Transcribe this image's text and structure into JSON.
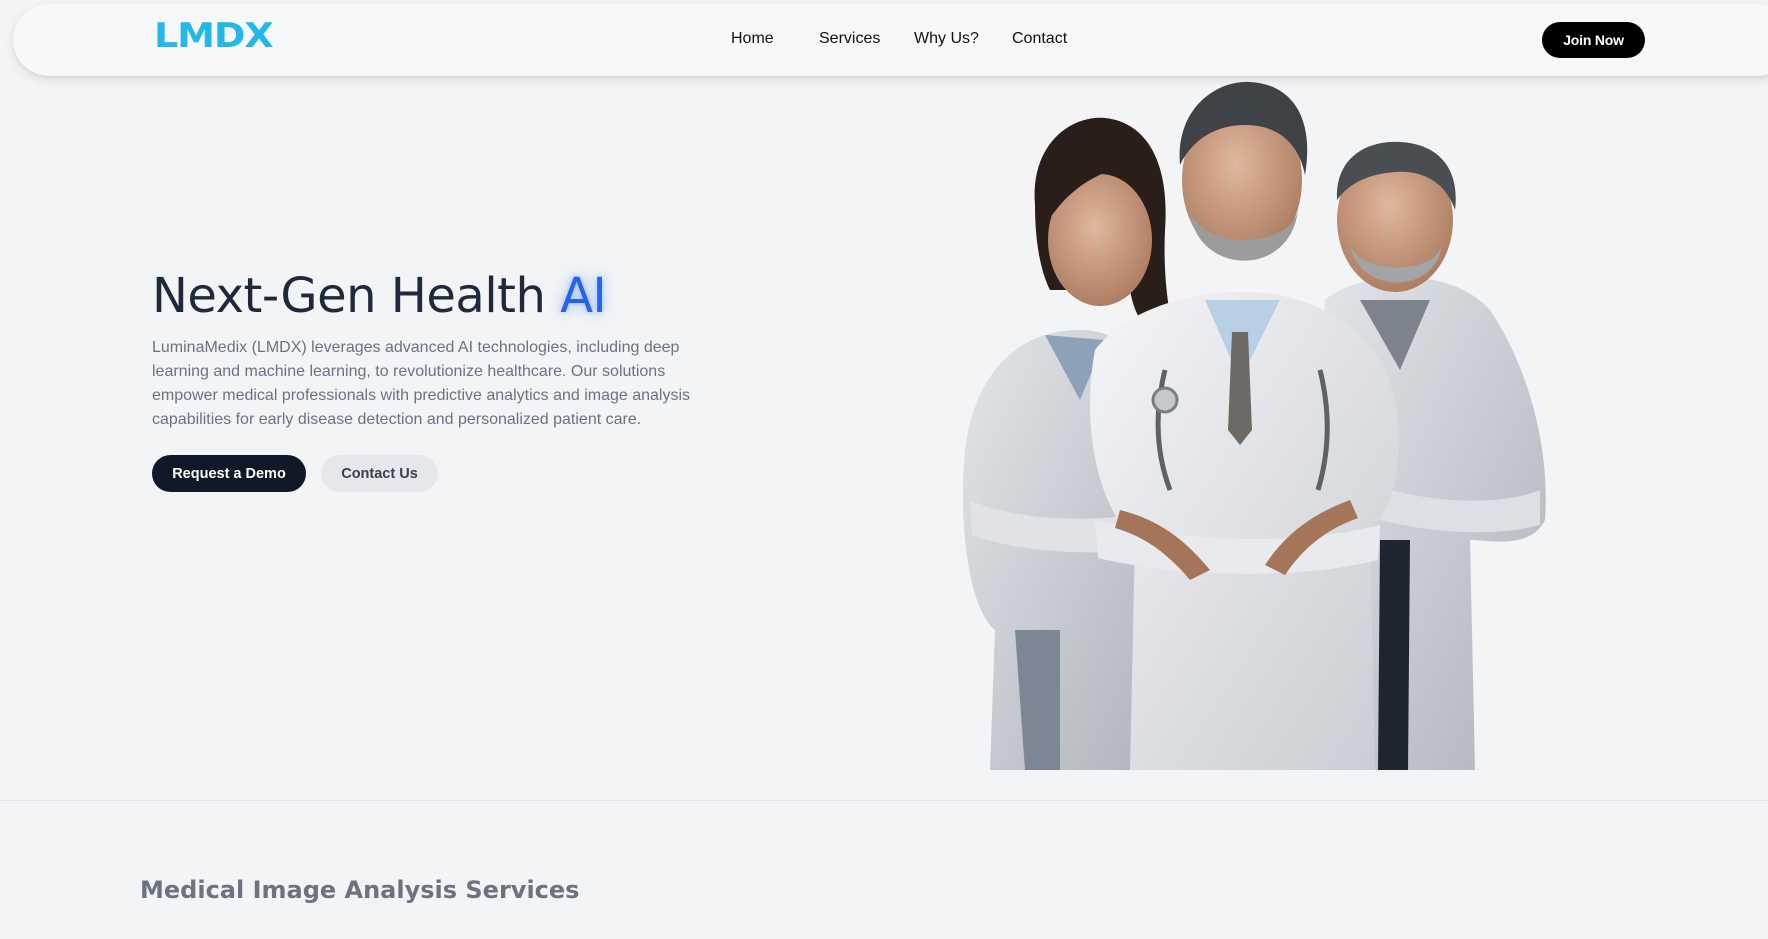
{
  "nav": {
    "logo_text": "LMDX",
    "links": [
      "Home",
      "Services",
      "Why Us?",
      "Contact"
    ],
    "cta_label": "Join Now"
  },
  "hero": {
    "title_main": "Next-Gen Health",
    "title_accent": "AI",
    "description": "LuminaMedix (LMDX) leverages advanced AI technologies, including deep learning and machine learning, to revolutionize healthcare. Our solutions empower medical professionals with predictive analytics and image analysis capabilities for early disease detection and personalized patient care.",
    "primary_button": "Request a Demo",
    "secondary_button": "Contact Us"
  },
  "section": {
    "title": "Medical Image Analysis Services"
  },
  "colors": {
    "logo": "#22b8ea",
    "accent": "#2563eb",
    "heading": "#1e293b",
    "dark_button": "#111827",
    "background": "#f3f4f6"
  }
}
